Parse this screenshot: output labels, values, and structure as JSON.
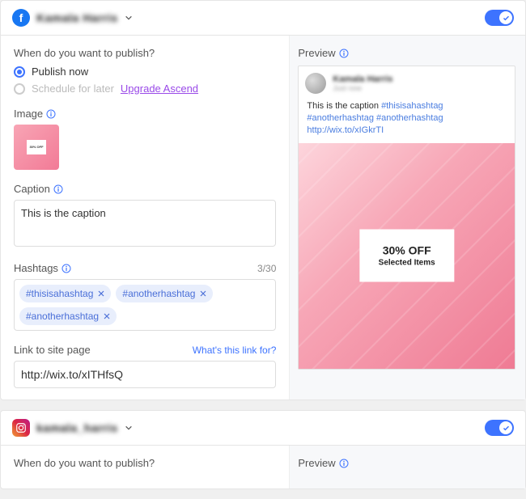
{
  "facebook": {
    "account_name": "Kamala Harris",
    "toggle_on": true,
    "publish_title": "When do you want to publish?",
    "publish_now": "Publish now",
    "schedule_later": "Schedule for later",
    "upgrade": "Upgrade Ascend",
    "image_label": "Image",
    "caption_label": "Caption",
    "caption_value": "This is the caption",
    "hashtags_label": "Hashtags",
    "hashtags_count": "3/30",
    "hashtags": [
      "#thisisahashtag",
      "#anotherhashtag",
      "#anotherhashtag"
    ],
    "link_label": "Link to site page",
    "link_help": "What's this link for?",
    "link_value": "http://wix.to/xITHfsQ",
    "preview_label": "Preview",
    "preview": {
      "name": "Kamala Harris",
      "sub": "Just now",
      "caption_text": "This is the caption",
      "caption_tags": "#thisisahashtag #anotherhashtag #anotherhashtag",
      "caption_link": "http://wix.to/xIGkrTI",
      "promo_line1": "30% OFF",
      "promo_line2": "Selected Items"
    }
  },
  "instagram": {
    "account_name": "kamala_harris",
    "toggle_on": true,
    "publish_title": "When do you want to publish?",
    "preview_label": "Preview"
  }
}
